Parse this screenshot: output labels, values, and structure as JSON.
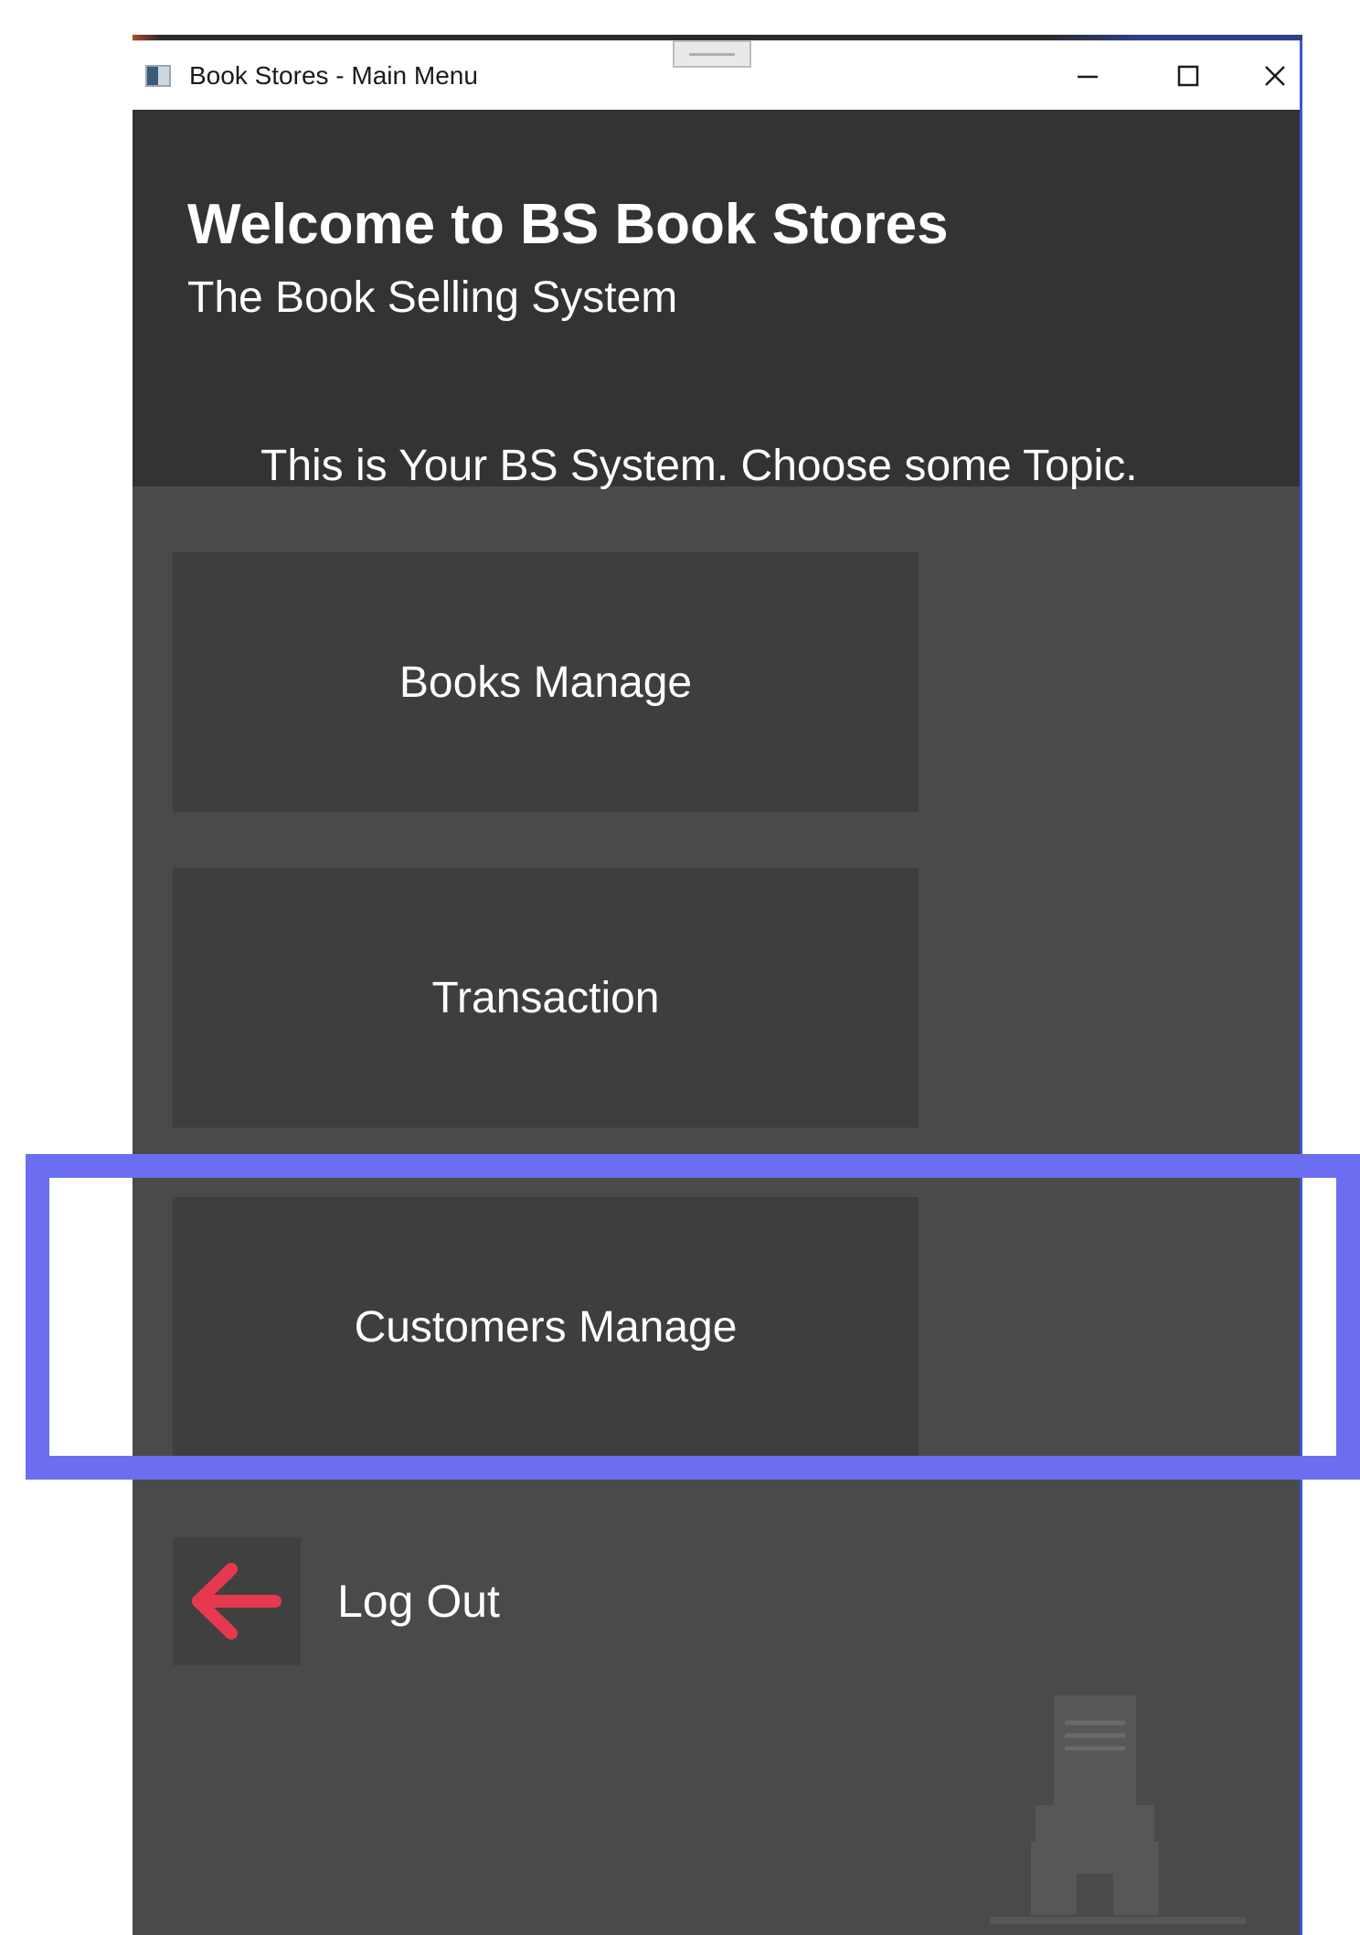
{
  "window": {
    "title": "Book Stores - Main Menu"
  },
  "header": {
    "title": "Welcome to BS Book Stores",
    "subtitle": "The Book Selling System",
    "message": "This is Your BS System. Choose some Topic."
  },
  "menu": {
    "books_label": "Books Manage",
    "transaction_label": "Transaction",
    "customers_label": "Customers Manage",
    "logout_label": "Log Out"
  },
  "colors": {
    "header_bg": "#333333",
    "content_bg": "#4a4a4a",
    "tile_bg": "#3e3e3e",
    "logout_arrow": "#e63950",
    "highlight": "#6b6ef0"
  },
  "icons": {
    "app": "app-window-icon",
    "minimize": "minimize-icon",
    "maximize": "maximize-icon",
    "close": "close-icon",
    "logout": "arrow-left-icon",
    "store": "bookstore-icon"
  }
}
